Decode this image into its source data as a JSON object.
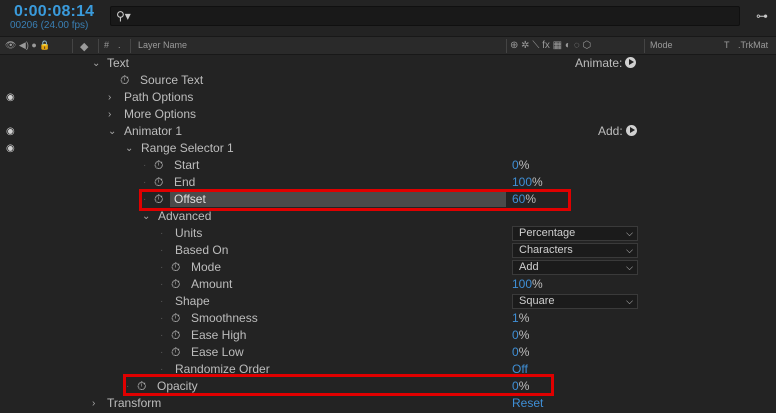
{
  "timecode": "0:00:08:14",
  "frame_info": "00206 (24.00 fps)",
  "header": {
    "layer_name": "Layer Name",
    "hash": "#",
    "mode": "Mode",
    "t": "T",
    "trkmat": ".TrkMat",
    "switch_icons": "⊕ ✲ ⟍ fx ▦ ◐ ◌ ⬡"
  },
  "rows": {
    "text": {
      "label": "Text",
      "action": "Animate:"
    },
    "source_text": {
      "label": "Source Text"
    },
    "path_options": {
      "label": "Path Options"
    },
    "more_options": {
      "label": "More Options"
    },
    "animator1": {
      "label": "Animator 1",
      "action": "Add:"
    },
    "range_selector": {
      "label": "Range Selector 1"
    },
    "start": {
      "label": "Start",
      "value": "0",
      "unit": "%"
    },
    "end": {
      "label": "End",
      "value": "100",
      "unit": "%"
    },
    "offset": {
      "label": "Offset",
      "value": "60",
      "unit": "%"
    },
    "advanced": {
      "label": "Advanced"
    },
    "units": {
      "label": "Units",
      "value": "Percentage"
    },
    "based_on": {
      "label": "Based On",
      "value": "Characters"
    },
    "mode": {
      "label": "Mode",
      "value": "Add"
    },
    "amount": {
      "label": "Amount",
      "value": "100",
      "unit": "%"
    },
    "shape": {
      "label": "Shape",
      "value": "Square"
    },
    "smoothness": {
      "label": "Smoothness",
      "value": "1",
      "unit": "%"
    },
    "ease_high": {
      "label": "Ease High",
      "value": "0",
      "unit": "%"
    },
    "ease_low": {
      "label": "Ease Low",
      "value": "0",
      "unit": "%"
    },
    "randomize": {
      "label": "Randomize Order",
      "value": "Off"
    },
    "opacity": {
      "label": "Opacity",
      "value": "0",
      "unit": "%"
    },
    "transform": {
      "label": "Transform",
      "value": "Reset"
    }
  },
  "colors": {
    "value_blue": "#3f8fd6",
    "highlight_red": "#e00000",
    "background": "#232323"
  }
}
